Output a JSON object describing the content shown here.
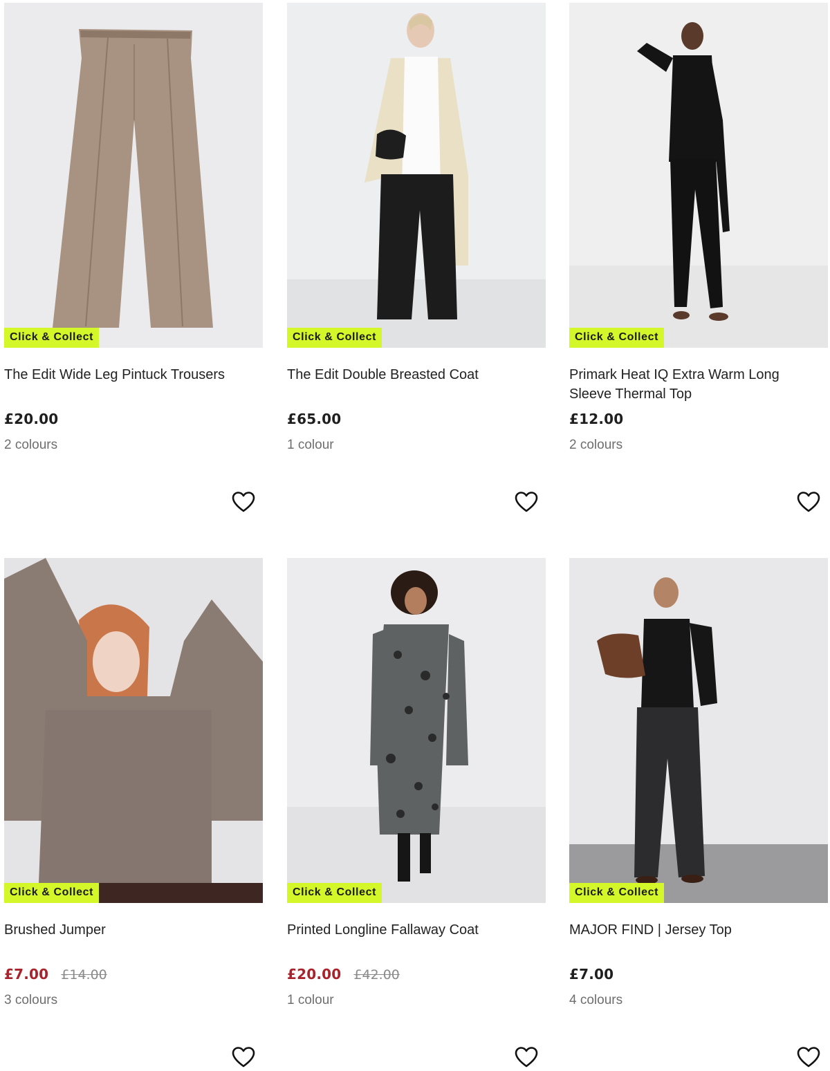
{
  "colors": {
    "badge_bg": "#d4f72a",
    "sale_price": "#a8232b",
    "image_bg": "#e6e6e8"
  },
  "products": [
    {
      "badge": "Click & Collect",
      "title": "The Edit Wide Leg Pintuck Trousers",
      "price": "£20.00",
      "was_price": "",
      "on_sale": false,
      "colours": "2 colours",
      "image": "wide-leg-trousers-image",
      "wishlist_icon": "heart-outline-icon"
    },
    {
      "badge": "Click & Collect",
      "title": "The Edit Double Breasted Coat",
      "price": "£65.00",
      "was_price": "",
      "on_sale": false,
      "colours": "1 colour",
      "image": "double-breasted-coat-image",
      "wishlist_icon": "heart-outline-icon"
    },
    {
      "badge": "Click & Collect",
      "title": "Primark Heat IQ Extra Warm Long Sleeve Thermal Top",
      "price": "£12.00",
      "was_price": "",
      "on_sale": false,
      "colours": "2 colours",
      "image": "thermal-top-image",
      "wishlist_icon": "heart-outline-icon"
    },
    {
      "badge": "Click & Collect",
      "title": "Brushed Jumper",
      "price": "£7.00",
      "was_price": "£14.00",
      "on_sale": true,
      "colours": "3 colours",
      "image": "brushed-jumper-image",
      "wishlist_icon": "heart-outline-icon"
    },
    {
      "badge": "Click & Collect",
      "title": "Printed Longline Fallaway Coat",
      "price": "£20.00",
      "was_price": "£42.00",
      "on_sale": true,
      "colours": "1 colour",
      "image": "longline-coat-image",
      "wishlist_icon": "heart-outline-icon"
    },
    {
      "badge": "Click & Collect",
      "title": "MAJOR FIND | Jersey Top",
      "price": "£7.00",
      "was_price": "",
      "on_sale": false,
      "colours": "4 colours",
      "image": "jersey-top-image",
      "wishlist_icon": "heart-outline-icon"
    }
  ]
}
